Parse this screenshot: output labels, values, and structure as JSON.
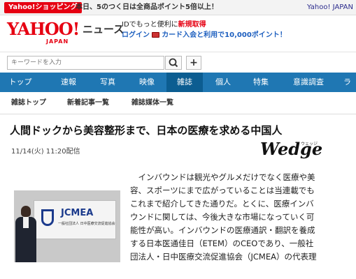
{
  "topbar": {
    "shopping_label": "Yahoo!ショッピング",
    "promo_text": "本日、5のつく日は全商品ポイント5倍以上！",
    "right_text": "Yahoo! JAPAN"
  },
  "header": {
    "logo_main": "YAHOO!",
    "logo_sub": "JAPAN",
    "section_name": "ニュース",
    "promo_line1_prefix": "IDでもっと便利に",
    "promo_line1_link": "新規取得",
    "promo_login": "ログイン",
    "promo_card_text": "カード入会と利用で10,000ポイント！"
  },
  "search": {
    "placeholder": "キーワードを入力",
    "plus_label": "+"
  },
  "nav": {
    "items": [
      "トップ",
      "速報",
      "写真",
      "映像",
      "雑誌",
      "個人",
      "特集",
      "意識調査",
      "ラ"
    ],
    "active": "雑誌"
  },
  "subnav": {
    "items": [
      "雑誌トップ",
      "新着記事一覧",
      "雑誌媒体一覧"
    ]
  },
  "article": {
    "title": "人間ドックから美容整形まで、日本の医療を求める中国人",
    "date": "11/14(火) 11:20配信",
    "publisher": "Wedge",
    "publisher_sub": "ウェッジ",
    "photo": {
      "sign_text": "JCMEA",
      "sign_small": "一般社団法人 日中医療交流促進協会"
    },
    "body_lines": [
      "　インバウンドは観光やグルメだけでなく医療や美",
      "容、スポーツにまで広がっていることは当連載でも",
      "これまで紹介してきた通りだ。とくに、医療インバ",
      "ウンドに関しては、今後大きな市場になっていく可",
      "能性が高い。インバウンドの医療通訳・翻訳を養成",
      "する日本医通佳日（ETEM）のCEOであり、一般社",
      "団法人・日中医療交流促進協会（JCMEA）の代表理"
    ]
  },
  "colors": {
    "brand_red": "#e60012",
    "nav_blue": "#1f77b3",
    "nav_active": "#0c5d91"
  }
}
